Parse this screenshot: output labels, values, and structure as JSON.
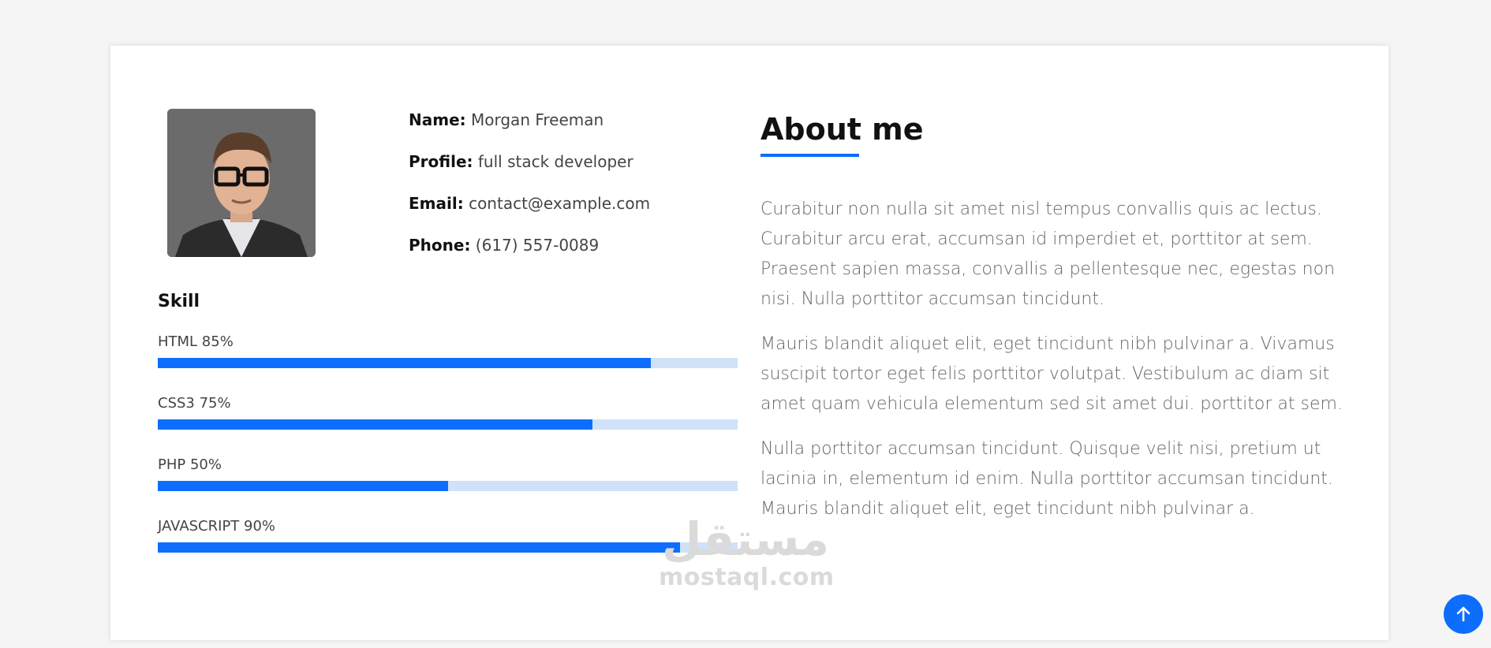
{
  "profile": {
    "rows": [
      {
        "key": "Name:",
        "value": "Morgan Freeman"
      },
      {
        "key": "Profile:",
        "value": "full stack developer"
      },
      {
        "key": "Email:",
        "value": "contact@example.com"
      },
      {
        "key": "Phone:",
        "value": "(617) 557-0089"
      }
    ]
  },
  "skills": {
    "title": "Skill",
    "items": [
      {
        "label": "HTML 85%",
        "value": 85
      },
      {
        "label": "CSS3 75%",
        "value": 75
      },
      {
        "label": "PHP 50%",
        "value": 50
      },
      {
        "label": "JAVASCRIPT 90%",
        "value": 90
      }
    ]
  },
  "about": {
    "title": "About me",
    "paragraphs": [
      "Curabitur non nulla sit amet nisl tempus convallis quis ac lectus. Curabitur arcu erat, accumsan id imperdiet et, porttitor at sem. Praesent sapien massa, convallis a pellentesque nec, egestas non nisi. Nulla porttitor accumsan tincidunt.",
      "Mauris blandit aliquet elit, eget tincidunt nibh pulvinar a. Vivamus suscipit tortor eget felis porttitor volutpat. Vestibulum ac diam sit amet quam vehicula elementum sed sit amet dui. porttitor at sem.",
      "Nulla porttitor accumsan tincidunt. Quisque velit nisi, pretium ut lacinia in, elementum id enim. Nulla porttitor accumsan tincidunt. Mauris blandit aliquet elit, eget tincidunt nibh pulvinar a."
    ]
  },
  "watermark": {
    "arabic": "مستقل",
    "latin": "mostaql.com"
  },
  "colors": {
    "accent": "#0d6efd",
    "track": "#cfe2f8"
  },
  "icons": {
    "back_to_top": "arrow-up-icon",
    "photo": "avatar"
  }
}
